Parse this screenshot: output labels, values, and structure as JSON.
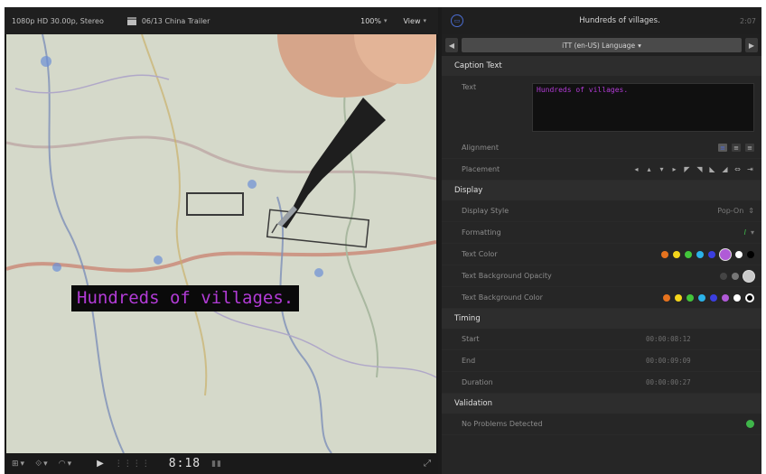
{
  "viewer": {
    "format_label": "1080p HD 30.00p, Stereo",
    "project_label": "06/13 China Trailer",
    "zoom_value": "100%",
    "view_label": "View",
    "caption_text": "Hundreds of villages.",
    "timecode": "8:18"
  },
  "inspector": {
    "title": "Hundreds of villages.",
    "duration": "2:07",
    "role_label": "iTT (en-US) Language",
    "sections": {
      "caption_text": "Caption Text",
      "display": "Display",
      "timing": "Timing",
      "validation": "Validation"
    },
    "labels": {
      "text": "Text",
      "alignment": "Alignment",
      "placement": "Placement",
      "display_style": "Display Style",
      "formatting": "Formatting",
      "text_color": "Text Color",
      "text_bg_opacity": "Text Background Opacity",
      "text_bg_color": "Text Background Color",
      "start": "Start",
      "end": "End",
      "duration": "Duration",
      "validation_status": "No Problems Detected"
    },
    "text_value": "Hundreds of villages.",
    "display_style_value": "Pop-On",
    "formatting_value": "I",
    "timing": {
      "start": "00:00:08:12",
      "end": "00:00:09:09",
      "duration": "00:00:00:27"
    },
    "colors": {
      "text": [
        "#e5721e",
        "#f3d51b",
        "#43c53b",
        "#2bb2e8",
        "#3b3fe0",
        "#b05ad7",
        "#ffffff",
        "#000000"
      ],
      "text_bg": [
        "#e5721e",
        "#f3d51b",
        "#43c53b",
        "#2bb2e8",
        "#3b3fe0",
        "#b05ad7",
        "#ffffff",
        "#000000"
      ],
      "accent": "#4a6cd0",
      "ok": "#3fb54a"
    }
  }
}
